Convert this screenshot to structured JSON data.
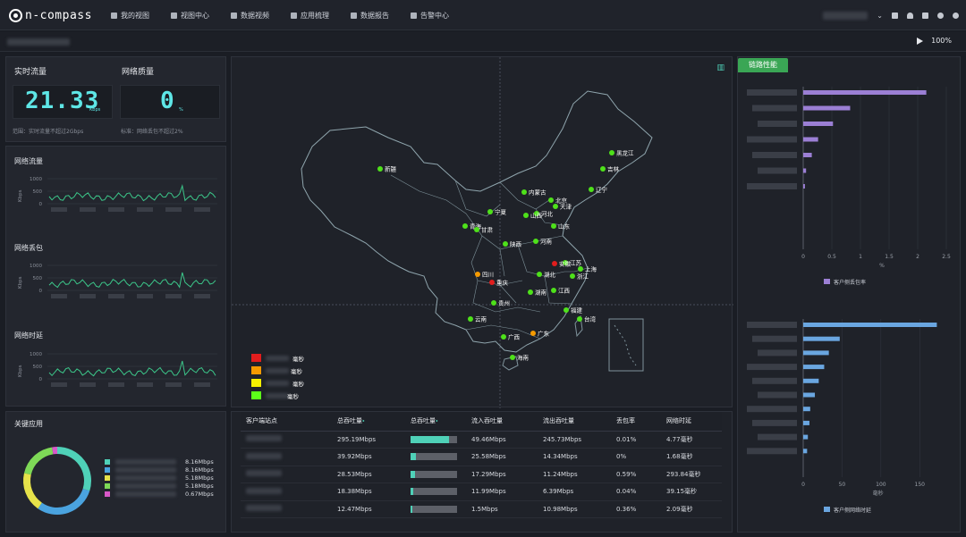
{
  "header": {
    "logo_text": "n-compass",
    "nav": [
      {
        "label": "我的视图",
        "icon": "heart-icon"
      },
      {
        "label": "视图中心",
        "icon": "grid-icon"
      },
      {
        "label": "数据视频",
        "icon": "monitor-icon"
      },
      {
        "label": "应用梳理",
        "icon": "tree-icon"
      },
      {
        "label": "数据报告",
        "icon": "report-icon"
      },
      {
        "label": "告警中心",
        "icon": "bell-icon"
      }
    ]
  },
  "subbar": {
    "zoom": "100%"
  },
  "realtime": {
    "flow_title": "实时流量",
    "flow_value": "21.33",
    "flow_unit": "Kbps",
    "flow_note": "范围：实时流量不超过2Gbps",
    "quality_title": "网络质量",
    "quality_value": "0",
    "quality_unit": "%",
    "quality_note": "标准：网络丢包不超过2%"
  },
  "mini_charts": [
    {
      "title": "网络流量",
      "ylabel": "Kbps",
      "ticks": [
        "1000",
        "500",
        "0"
      ]
    },
    {
      "title": "网络丢包",
      "ylabel": "Kbps",
      "ticks": [
        "1000",
        "500",
        "0"
      ]
    },
    {
      "title": "网络时延",
      "ylabel": "Kbps",
      "ticks": [
        "1000",
        "500",
        "0"
      ]
    }
  ],
  "key_apps": {
    "title": "关键应用",
    "items": [
      {
        "value": "8.16Mbps",
        "color": "#4fd1b8"
      },
      {
        "value": "8.16Mbps",
        "color": "#4aa3df"
      },
      {
        "value": "5.18Mbps",
        "color": "#e6e24a"
      },
      {
        "value": "5.18Mbps",
        "color": "#7ed957"
      },
      {
        "value": "0.67Mbps",
        "color": "#d858c8"
      }
    ]
  },
  "map": {
    "cities": [
      {
        "name": "黑龙江",
        "status": "green"
      },
      {
        "name": "吉林",
        "status": "green"
      },
      {
        "name": "辽宁",
        "status": "green"
      },
      {
        "name": "新疆",
        "status": "green"
      },
      {
        "name": "内蒙古",
        "status": "green"
      },
      {
        "name": "北京",
        "status": "green"
      },
      {
        "name": "天津",
        "status": "green"
      },
      {
        "name": "河北",
        "status": "green"
      },
      {
        "name": "山西",
        "status": "green"
      },
      {
        "name": "宁夏",
        "status": "green"
      },
      {
        "name": "青海",
        "status": "green"
      },
      {
        "name": "甘肃",
        "status": "green"
      },
      {
        "name": "陕西",
        "status": "green"
      },
      {
        "name": "河南",
        "status": "green"
      },
      {
        "name": "山东",
        "status": "green"
      },
      {
        "name": "江苏",
        "status": "green"
      },
      {
        "name": "安徽",
        "status": "red"
      },
      {
        "name": "上海",
        "status": "green"
      },
      {
        "name": "浙江",
        "status": "green"
      },
      {
        "name": "湖北",
        "status": "green"
      },
      {
        "name": "四川",
        "status": "orange"
      },
      {
        "name": "重庆",
        "status": "red"
      },
      {
        "name": "湖南",
        "status": "green"
      },
      {
        "name": "江西",
        "status": "green"
      },
      {
        "name": "贵州",
        "status": "green"
      },
      {
        "name": "云南",
        "status": "green"
      },
      {
        "name": "广西",
        "status": "green"
      },
      {
        "name": "广东",
        "status": "orange"
      },
      {
        "name": "福建",
        "status": "green"
      },
      {
        "name": "台湾",
        "status": "green"
      },
      {
        "name": "海南",
        "status": "green"
      }
    ],
    "legend": [
      {
        "color": "#e11d1d",
        "label": "毫秒"
      },
      {
        "color": "#f59a00",
        "label": "毫秒"
      },
      {
        "color": "#f5f000",
        "label": "毫秒"
      },
      {
        "color": "#5cff1a",
        "label": "毫秒"
      }
    ]
  },
  "table": {
    "headers": [
      "客户端站点",
      "总吞吐量",
      "总吞吐量",
      "流入吞吐量",
      "流出吞吐量",
      "丢包率",
      "网络时延"
    ],
    "rows": [
      {
        "total": "295.19Mbps",
        "bar": 0.82,
        "in": "49.46Mbps",
        "out": "245.73Mbps",
        "loss": "0.01%",
        "lat": "4.77毫秒"
      },
      {
        "total": "39.92Mbps",
        "bar": 0.12,
        "in": "25.58Mbps",
        "out": "14.34Mbps",
        "loss": "0%",
        "lat": "1.68毫秒"
      },
      {
        "total": "28.53Mbps",
        "bar": 0.09,
        "in": "17.29Mbps",
        "out": "11.24Mbps",
        "loss": "0.59%",
        "lat": "293.84毫秒"
      },
      {
        "total": "18.38Mbps",
        "bar": 0.06,
        "in": "11.99Mbps",
        "out": "6.39Mbps",
        "loss": "0.04%",
        "lat": "39.15毫秒"
      },
      {
        "total": "12.47Mbps",
        "bar": 0.04,
        "in": "1.5Mbps",
        "out": "10.98Mbps",
        "loss": "0.36%",
        "lat": "2.09毫秒"
      }
    ]
  },
  "right": {
    "tab": "链路性能",
    "chart_data": [
      {
        "type": "bar",
        "orientation": "horizontal",
        "color": "#9b7fd4",
        "values": [
          2.15,
          0.82,
          0.52,
          0.26,
          0.15,
          0.05,
          0.03
        ],
        "xlim": [
          0,
          2.5
        ],
        "ticks": [
          "0",
          "0.5",
          "1",
          "1.5",
          "2",
          "2.5"
        ],
        "xlabel": "%",
        "legend": "客户侧丢包率"
      },
      {
        "type": "bar",
        "orientation": "horizontal",
        "color": "#6aa6e0",
        "values": [
          172,
          47,
          33,
          27,
          20,
          15,
          9,
          8,
          6,
          5
        ],
        "xlim": [
          0,
          175
        ],
        "ticks": [
          "0",
          "50",
          "100",
          "150"
        ],
        "xlabel": "毫秒",
        "legend": "客户侧网络时延"
      }
    ]
  }
}
